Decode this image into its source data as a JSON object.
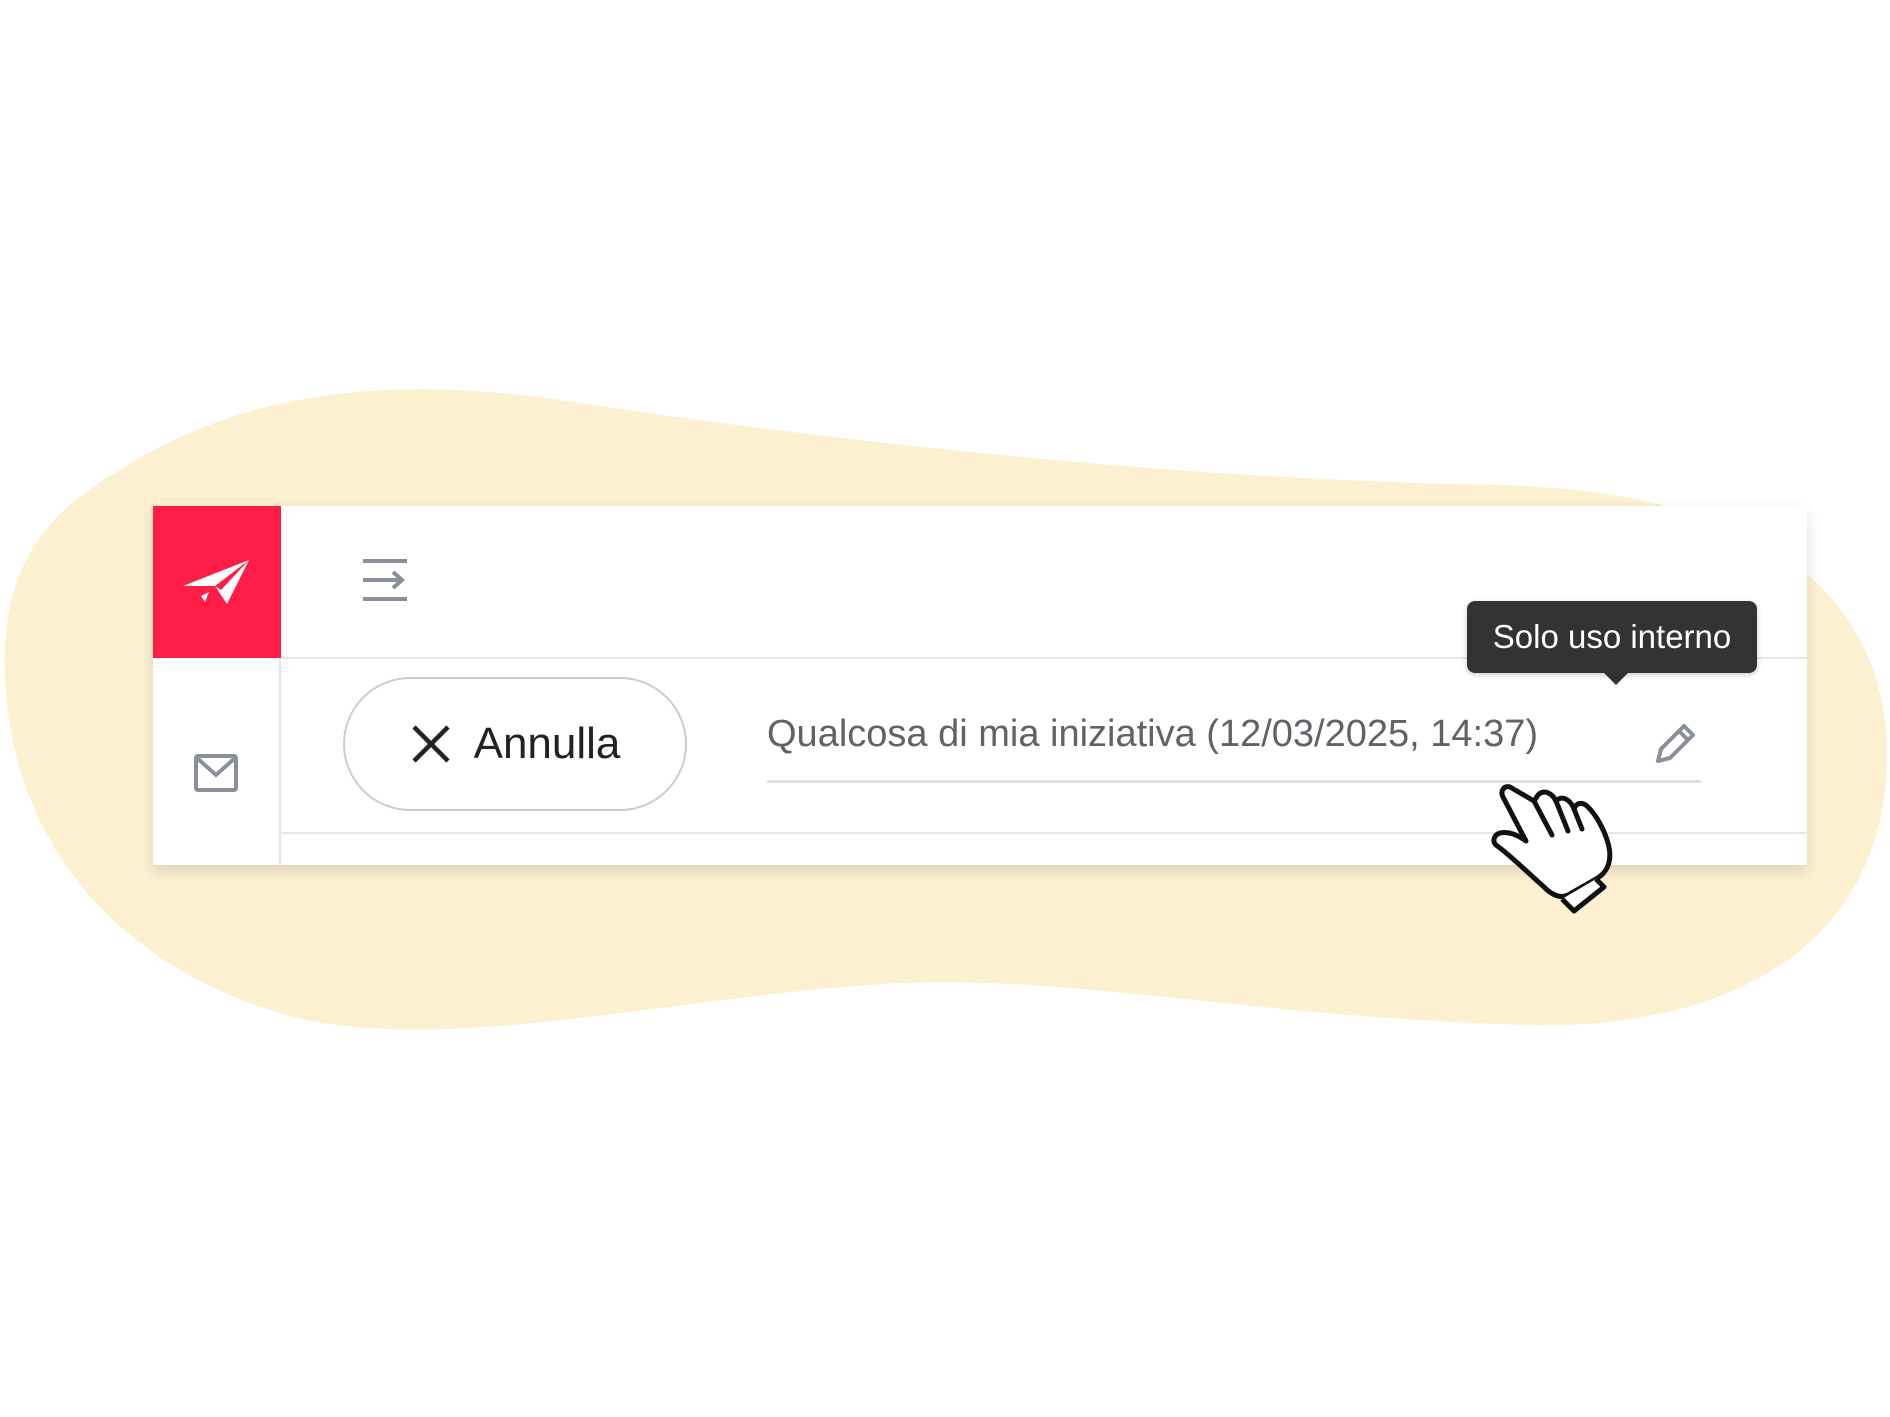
{
  "colors": {
    "brand": "#ff1d47",
    "blob": "#fcf0d1",
    "tooltip_bg": "#333333",
    "muted_text": "#5f6368"
  },
  "icons": {
    "brand": "paper-plane-icon",
    "rail": "mail-icon",
    "toggle": "menu-collapse-icon",
    "cancel": "close-icon",
    "edit": "pencil-icon",
    "pointer": "hand-pointer-icon"
  },
  "toolbar": {
    "cancel_label": "Annulla"
  },
  "note": {
    "value": "Qualcosa di mia iniziativa (12/03/2025, 14:37)"
  },
  "tooltip": {
    "text": "Solo uso interno"
  }
}
